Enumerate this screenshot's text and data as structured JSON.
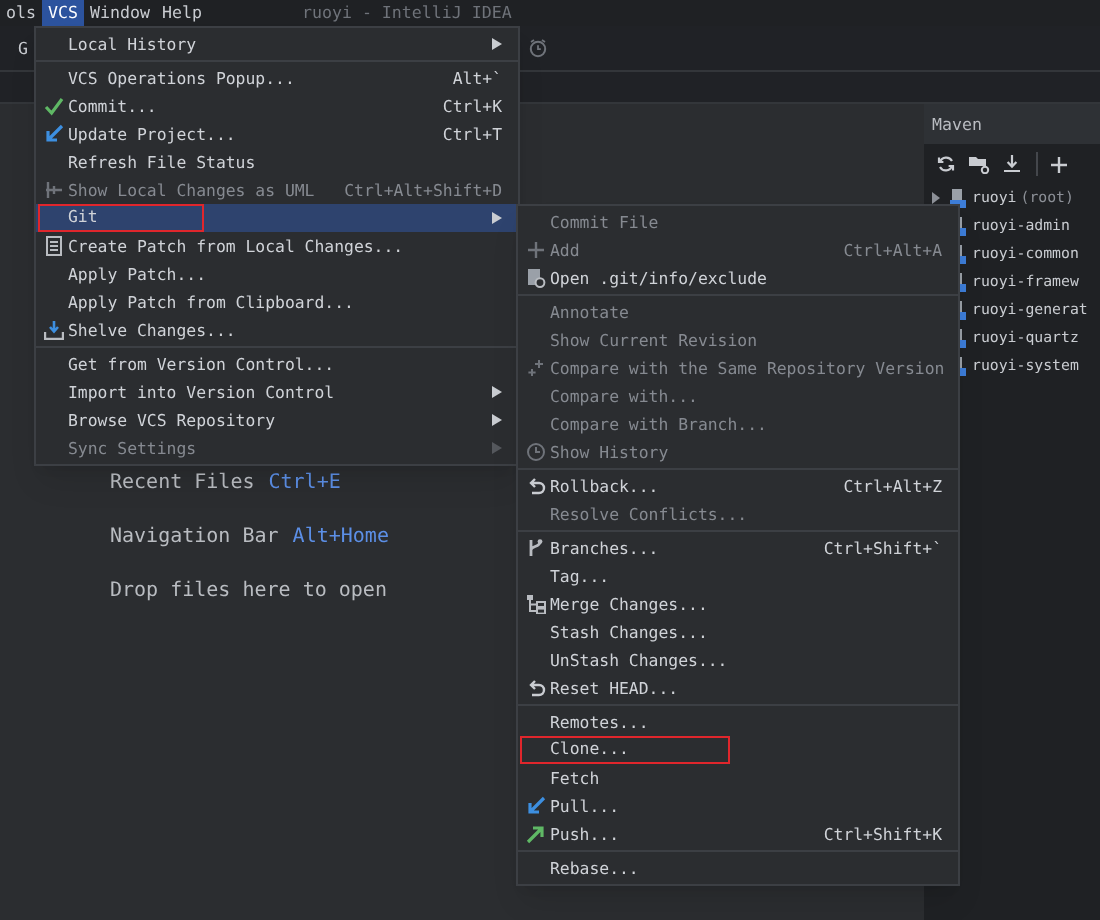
{
  "menu_bar": [
    {
      "label": "ols",
      "selected": false
    },
    {
      "label": "VCS",
      "selected": true
    },
    {
      "label": "Window",
      "selected": false
    },
    {
      "label": "Help",
      "selected": false
    }
  ],
  "window": {
    "title": "ruoyi - IntelliJ IDEA"
  },
  "toolbar": {
    "label": "G"
  },
  "editor_hints": [
    {
      "label": "Recent Files",
      "shortcut": "Ctrl+E"
    },
    {
      "label": "Navigation Bar",
      "shortcut": "Alt+Home"
    },
    {
      "label": "Drop files here to open"
    }
  ],
  "maven": {
    "title": "Maven",
    "tree": [
      {
        "label": "ruoyi",
        "suffix": "(root)",
        "expanded": false
      },
      {
        "label": "ruoyi-admin"
      },
      {
        "label": "ruoyi-common"
      },
      {
        "label": "ruoyi-framew"
      },
      {
        "label": "ruoyi-generat"
      },
      {
        "label": "ruoyi-quartz"
      },
      {
        "label": "ruoyi-system"
      }
    ]
  },
  "vcs_menu": [
    {
      "kind": "item",
      "label": "Local History",
      "submenu": true,
      "disabled": false,
      "selected": false,
      "outlined": false
    },
    {
      "kind": "separator"
    },
    {
      "kind": "item",
      "label": "VCS Operations Popup...",
      "shortcut": "Alt+`",
      "disabled": false,
      "selected": false,
      "outlined": false
    },
    {
      "kind": "item",
      "label": "Commit...",
      "shortcut": "Ctrl+K",
      "disabled": false,
      "selected": false,
      "outlined": false
    },
    {
      "kind": "item",
      "label": "Update Project...",
      "shortcut": "Ctrl+T",
      "disabled": false,
      "selected": false,
      "outlined": false
    },
    {
      "kind": "item",
      "label": "Refresh File Status",
      "disabled": false,
      "selected": false,
      "outlined": false
    },
    {
      "kind": "item",
      "label": "Show Local Changes as UML",
      "shortcut": "Ctrl+Alt+Shift+D",
      "disabled": true,
      "selected": false,
      "outlined": false
    },
    {
      "kind": "item",
      "label": "Git",
      "submenu": true,
      "disabled": false,
      "selected": true,
      "outlined": true
    },
    {
      "kind": "item",
      "label": "Create Patch from Local Changes...",
      "disabled": false,
      "selected": false,
      "outlined": false
    },
    {
      "kind": "item",
      "label": "Apply Patch...",
      "disabled": false,
      "selected": false,
      "outlined": false
    },
    {
      "kind": "item",
      "label": "Apply Patch from Clipboard...",
      "disabled": false,
      "selected": false,
      "outlined": false
    },
    {
      "kind": "item",
      "label": "Shelve Changes...",
      "disabled": false,
      "selected": false,
      "outlined": false
    },
    {
      "kind": "separator"
    },
    {
      "kind": "item",
      "label": "Get from Version Control...",
      "disabled": false,
      "selected": false,
      "outlined": false
    },
    {
      "kind": "item",
      "label": "Import into Version Control",
      "submenu": true,
      "disabled": false,
      "selected": false,
      "outlined": false
    },
    {
      "kind": "item",
      "label": "Browse VCS Repository",
      "submenu": true,
      "disabled": false,
      "selected": false,
      "outlined": false
    },
    {
      "kind": "item",
      "label": "Sync Settings",
      "submenu": true,
      "disabled": true,
      "selected": false,
      "outlined": false
    }
  ],
  "git_menu": [
    {
      "kind": "item",
      "label": "Commit File",
      "disabled": true,
      "outlined": false
    },
    {
      "kind": "item",
      "label": "Add",
      "shortcut": "Ctrl+Alt+A",
      "disabled": true,
      "outlined": false
    },
    {
      "kind": "item",
      "label": "Open .git/info/exclude",
      "disabled": false,
      "outlined": false
    },
    {
      "kind": "separator"
    },
    {
      "kind": "item",
      "label": "Annotate",
      "disabled": true,
      "outlined": false
    },
    {
      "kind": "item",
      "label": "Show Current Revision",
      "disabled": true,
      "outlined": false
    },
    {
      "kind": "item",
      "label": "Compare with the Same Repository Version",
      "disabled": true,
      "outlined": false
    },
    {
      "kind": "item",
      "label": "Compare with...",
      "disabled": true,
      "outlined": false
    },
    {
      "kind": "item",
      "label": "Compare with Branch...",
      "disabled": true,
      "outlined": false
    },
    {
      "kind": "item",
      "label": "Show History",
      "disabled": true,
      "outlined": false
    },
    {
      "kind": "separator"
    },
    {
      "kind": "item",
      "label": "Rollback...",
      "shortcut": "Ctrl+Alt+Z",
      "disabled": false,
      "outlined": false
    },
    {
      "kind": "item",
      "label": "Resolve Conflicts...",
      "disabled": true,
      "outlined": false
    },
    {
      "kind": "separator"
    },
    {
      "kind": "item",
      "label": "Branches...",
      "shortcut": "Ctrl+Shift+`",
      "disabled": false,
      "outlined": false
    },
    {
      "kind": "item",
      "label": "Tag...",
      "disabled": false,
      "outlined": false
    },
    {
      "kind": "item",
      "label": "Merge Changes...",
      "disabled": false,
      "outlined": false
    },
    {
      "kind": "item",
      "label": "Stash Changes...",
      "disabled": false,
      "outlined": false
    },
    {
      "kind": "item",
      "label": "UnStash Changes...",
      "disabled": false,
      "outlined": false
    },
    {
      "kind": "item",
      "label": "Reset HEAD...",
      "disabled": false,
      "outlined": false
    },
    {
      "kind": "separator"
    },
    {
      "kind": "item",
      "label": "Remotes...",
      "disabled": false,
      "outlined": false
    },
    {
      "kind": "item",
      "label": "Clone...",
      "disabled": false,
      "outlined": true
    },
    {
      "kind": "item",
      "label": "Fetch",
      "disabled": false,
      "outlined": false
    },
    {
      "kind": "item",
      "label": "Pull...",
      "disabled": false,
      "outlined": false
    },
    {
      "kind": "item",
      "label": "Push...",
      "shortcut": "Ctrl+Shift+K",
      "disabled": false,
      "outlined": false
    },
    {
      "kind": "separator"
    },
    {
      "kind": "item",
      "label": "Rebase...",
      "disabled": false,
      "outlined": false
    }
  ]
}
